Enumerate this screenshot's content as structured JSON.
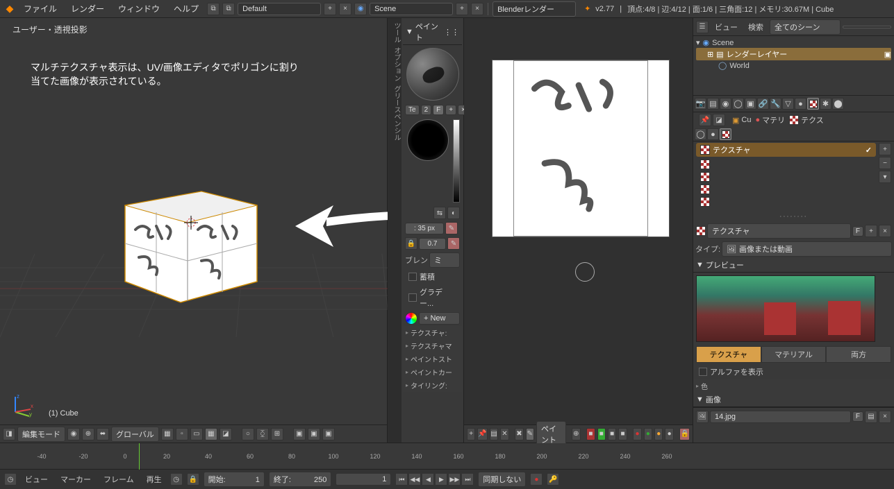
{
  "topbar": {
    "blender_icon": "◆",
    "menus": [
      "ファイル",
      "レンダー",
      "ウィンドウ",
      "ヘルプ"
    ],
    "layout_field": "Default",
    "scene_field": "Scene",
    "renderer": "Blenderレンダー",
    "version": "v2.77",
    "stats": "頂点:4/8 | 辺:4/12 | 面:1/6 | 三角面:12 | メモリ:30.67M | Cube"
  },
  "viewport": {
    "user_persp": "ユーザー・透視投影",
    "overlay_line1": "マルチテクスチャ表示は、UV/画像エディタでポリゴンに割り",
    "overlay_line2": "当てた画像が表示されている。",
    "object_name": "(1) Cube",
    "header": {
      "mode": "編集モード",
      "orientation": "グローバル"
    }
  },
  "toolshelf": {
    "tabs": [
      "ツール",
      "オプション",
      "グリースペンシル"
    ],
    "panel_title": "ペイント",
    "tex_btn": "Te",
    "num_btn": "2",
    "f_btn": "F",
    "radius": ": 35 px",
    "strength": "0.7",
    "blend_label": "ブレン",
    "blend_value": "ミ",
    "accumulate": "蓄積",
    "gradient": "グラデー...",
    "new_btn": "New",
    "collapsers": [
      "テクスチャ:",
      "テクスチャマ",
      "ペイントスト",
      "ペイントカー",
      "タイリング:"
    ]
  },
  "uv_header": {
    "mode": "ペイント"
  },
  "outliner": {
    "view_label": "ビュー",
    "search_label": "検索",
    "filter": "全てのシーン",
    "tree": {
      "scene": "Scene",
      "render_layers": "レンダーレイヤー",
      "world": "World"
    }
  },
  "properties": {
    "context_tabs": {
      "cube": "Cu",
      "material": "マテリ",
      "texture": "テクス"
    },
    "texture_name": "テクスチャ",
    "tex_id_field": "テクスチャ",
    "type_label": "タイプ:",
    "type_value": "画像または動画",
    "preview_label": "プレビュー",
    "tabs3": [
      "テクスチャ",
      "マテリアル",
      "両方"
    ],
    "alpha_label": "アルファを表示",
    "color_label": "色",
    "image_label": "画像",
    "image_file": "14.jpg",
    "f_btn": "F"
  },
  "timeline": {
    "ticks": [
      "-40",
      "-20",
      "0",
      "20",
      "40",
      "60",
      "80",
      "100",
      "120",
      "140",
      "160",
      "180",
      "200",
      "220",
      "240",
      "260"
    ],
    "menus": [
      "ビュー",
      "マーカー",
      "フレーム",
      "再生"
    ],
    "start_label": "開始:",
    "start_val": "1",
    "end_label": "終了:",
    "end_val": "250",
    "current": "1",
    "sync": "同期しない"
  }
}
